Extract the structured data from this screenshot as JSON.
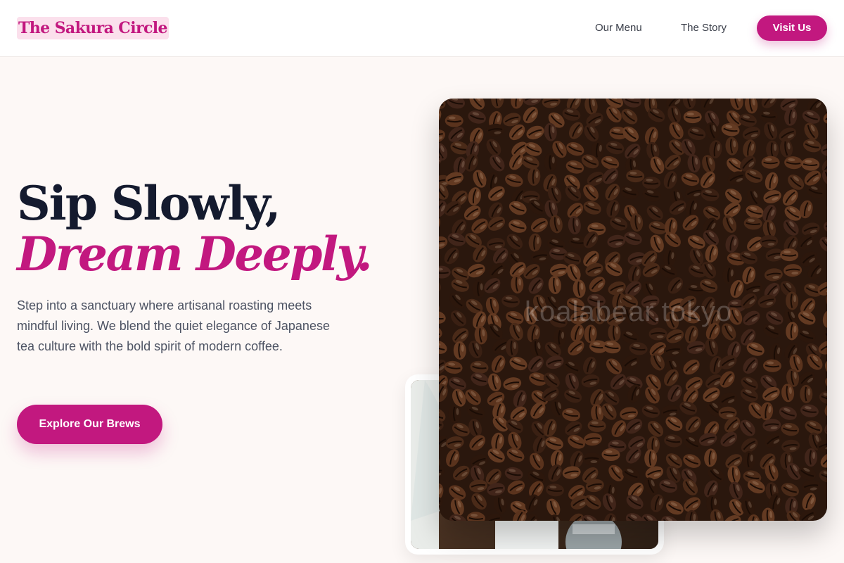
{
  "brand": {
    "name": "The Sakura Circle"
  },
  "nav": {
    "links": [
      "Our Menu",
      "The Story"
    ],
    "cta_label": "Visit Us"
  },
  "hero": {
    "headline_line1": "Sip Slowly,",
    "headline_line2": "Dream Deeply.",
    "description": "Step into a sanctuary where artisanal roasting meets mindful living. We blend the quiet elegance of Japanese tea culture with the bold spirit of modern coffee.",
    "cta_label": "Explore Our Brews"
  },
  "media": {
    "watermark": "koalabear.tokyo"
  },
  "colors": {
    "accent": "#c2187f",
    "heading": "#141a2e",
    "background": "#fdf8f6"
  }
}
